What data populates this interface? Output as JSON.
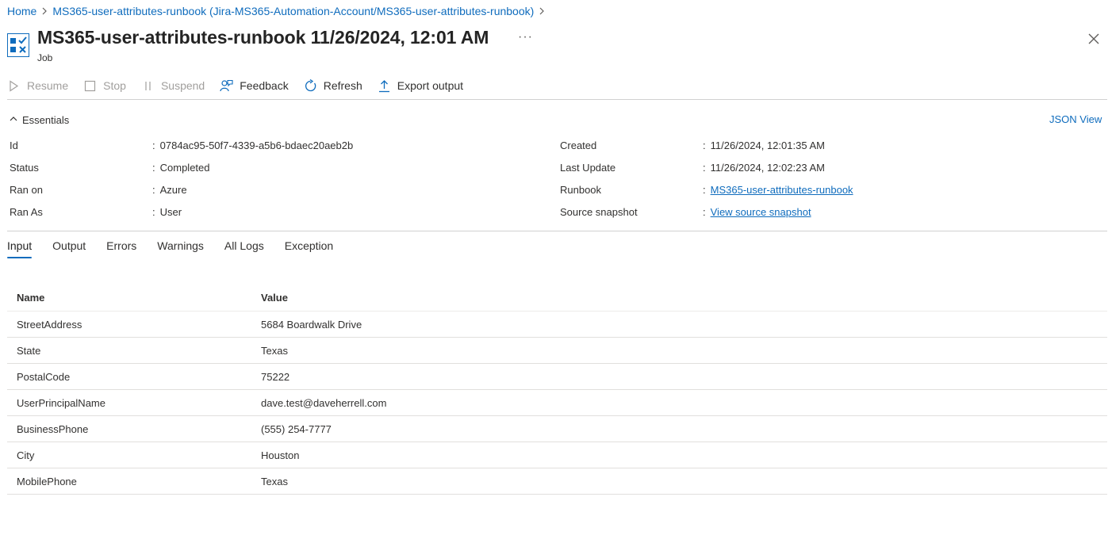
{
  "breadcrumb": {
    "home": "Home",
    "runbook": "MS365-user-attributes-runbook (Jira-MS365-Automation-Account/MS365-user-attributes-runbook)"
  },
  "header": {
    "title": "MS365-user-attributes-runbook 11/26/2024, 12:01 AM",
    "subtitle": "Job",
    "more": "···"
  },
  "toolbar": {
    "resume": "Resume",
    "stop": "Stop",
    "suspend": "Suspend",
    "feedback": "Feedback",
    "refresh": "Refresh",
    "export": "Export output"
  },
  "essentials": {
    "toggle_label": "Essentials",
    "json_view": "JSON View",
    "left": [
      {
        "label": "Id",
        "value": "0784ac95-50f7-4339-a5b6-bdaec20aeb2b"
      },
      {
        "label": "Status",
        "value": "Completed"
      },
      {
        "label": "Ran on",
        "value": "Azure"
      },
      {
        "label": "Ran As",
        "value": "User"
      }
    ],
    "right": [
      {
        "label": "Created",
        "value": "11/26/2024, 12:01:35 AM"
      },
      {
        "label": "Last Update",
        "value": "11/26/2024, 12:02:23 AM"
      },
      {
        "label": "Runbook",
        "value": "MS365-user-attributes-runbook"
      },
      {
        "label": "Source snapshot",
        "value": "View source snapshot"
      }
    ]
  },
  "tabs": [
    "Input",
    "Output",
    "Errors",
    "Warnings",
    "All Logs",
    "Exception"
  ],
  "active_tab": "Input",
  "table": {
    "headers": [
      "Name",
      "Value"
    ],
    "rows": [
      [
        "StreetAddress",
        "5684 Boardwalk Drive"
      ],
      [
        "State",
        "Texas"
      ],
      [
        "PostalCode",
        "75222"
      ],
      [
        "UserPrincipalName",
        "dave.test@daveherrell.com"
      ],
      [
        "BusinessPhone",
        "(555) 254-7777"
      ],
      [
        "City",
        "Houston"
      ],
      [
        "MobilePhone",
        "Texas"
      ]
    ]
  },
  "colors": {
    "link": "#0f6cbd",
    "text": "#323130",
    "disabled": "#a19f9d",
    "divider": "#d1d1d1"
  }
}
